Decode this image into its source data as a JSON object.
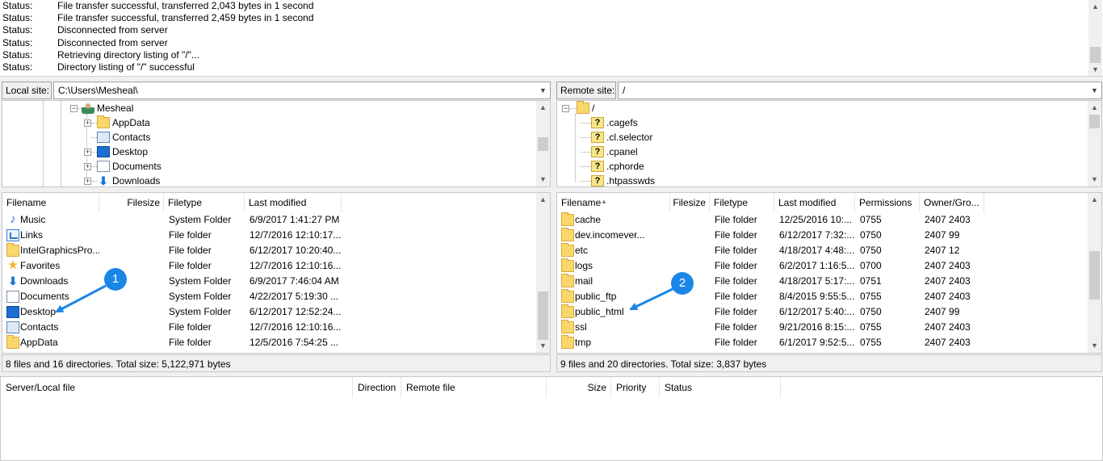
{
  "log": {
    "lines": [
      {
        "label": "Status:",
        "text": "File transfer successful, transferred 2,043 bytes in 1 second"
      },
      {
        "label": "Status:",
        "text": "File transfer successful, transferred 2,459 bytes in 1 second"
      },
      {
        "label": "Status:",
        "text": "Disconnected from server"
      },
      {
        "label": "Status:",
        "text": "Disconnected from server"
      },
      {
        "label": "Status:",
        "text": "Retrieving directory listing of \"/\"..."
      },
      {
        "label": "Status:",
        "text": "Directory listing of \"/\" successful"
      }
    ]
  },
  "local": {
    "site_label": "Local site:",
    "path": "C:\\Users\\Mesheal\\",
    "tree": [
      {
        "label": "Mesheal",
        "icon": "user-icon",
        "expander": "−"
      },
      {
        "label": "AppData",
        "icon": "folder-icon",
        "expander": "+"
      },
      {
        "label": "Contacts",
        "icon": "contacts-icon",
        "expander": ""
      },
      {
        "label": "Desktop",
        "icon": "desktop-icon",
        "expander": "+"
      },
      {
        "label": "Documents",
        "icon": "document-icon",
        "expander": "+"
      },
      {
        "label": "Downloads",
        "icon": "downloads-icon",
        "expander": "+"
      }
    ],
    "columns": {
      "filename": "Filename",
      "filesize": "Filesize",
      "filetype": "Filetype",
      "modified": "Last modified"
    },
    "files": [
      {
        "name": "Music",
        "size": "",
        "type": "System Folder",
        "modified": "6/9/2017 1:41:27 PM",
        "icon": "music-icon"
      },
      {
        "name": "Links",
        "size": "",
        "type": "File folder",
        "modified": "12/7/2016 12:10:17...",
        "icon": "links-icon"
      },
      {
        "name": "IntelGraphicsPro...",
        "size": "",
        "type": "File folder",
        "modified": "6/12/2017 10:20:40...",
        "icon": "folder-icon"
      },
      {
        "name": "Favorites",
        "size": "",
        "type": "File folder",
        "modified": "12/7/2016 12:10:16...",
        "icon": "star-icon"
      },
      {
        "name": "Downloads",
        "size": "",
        "type": "System Folder",
        "modified": "6/9/2017 7:46:04 AM",
        "icon": "downloads-icon"
      },
      {
        "name": "Documents",
        "size": "",
        "type": "System Folder",
        "modified": "4/22/2017 5:19:30 ...",
        "icon": "document-icon"
      },
      {
        "name": "Desktop",
        "size": "",
        "type": "System Folder",
        "modified": "6/12/2017 12:52:24...",
        "icon": "desktop-icon"
      },
      {
        "name": "Contacts",
        "size": "",
        "type": "File folder",
        "modified": "12/7/2016 12:10:16...",
        "icon": "contacts-icon"
      },
      {
        "name": "AppData",
        "size": "",
        "type": "File folder",
        "modified": "12/5/2016 7:54:25 ...",
        "icon": "folder-icon"
      }
    ],
    "status": "8 files and 16 directories. Total size: 5,122,971 bytes"
  },
  "remote": {
    "site_label": "Remote site:",
    "path": "/",
    "tree": [
      {
        "label": "/",
        "icon": "folder-icon",
        "expander": "−"
      },
      {
        "label": ".cagefs",
        "icon": "unknown-folder-icon",
        "expander": ""
      },
      {
        "label": ".cl.selector",
        "icon": "unknown-folder-icon",
        "expander": ""
      },
      {
        "label": ".cpanel",
        "icon": "unknown-folder-icon",
        "expander": ""
      },
      {
        "label": ".cphorde",
        "icon": "unknown-folder-icon",
        "expander": ""
      },
      {
        "label": ".htpasswds",
        "icon": "unknown-folder-icon",
        "expander": ""
      }
    ],
    "unknown_glyph": "?",
    "columns": {
      "filename": "Filename",
      "filesize": "Filesize",
      "filetype": "Filetype",
      "modified": "Last modified",
      "permissions": "Permissions",
      "owner": "Owner/Gro..."
    },
    "files": [
      {
        "name": "cache",
        "size": "",
        "type": "File folder",
        "modified": "12/25/2016 10:...",
        "perm": "0755",
        "owner": "2407 2403"
      },
      {
        "name": "dev.incomever...",
        "size": "",
        "type": "File folder",
        "modified": "6/12/2017 7:32:...",
        "perm": "0750",
        "owner": "2407 99"
      },
      {
        "name": "etc",
        "size": "",
        "type": "File folder",
        "modified": "4/18/2017 4:48:...",
        "perm": "0750",
        "owner": "2407 12"
      },
      {
        "name": "logs",
        "size": "",
        "type": "File folder",
        "modified": "6/2/2017 1:16:5...",
        "perm": "0700",
        "owner": "2407 2403"
      },
      {
        "name": "mail",
        "size": "",
        "type": "File folder",
        "modified": "4/18/2017 5:17:...",
        "perm": "0751",
        "owner": "2407 2403"
      },
      {
        "name": "public_ftp",
        "size": "",
        "type": "File folder",
        "modified": "8/4/2015 9:55:5...",
        "perm": "0755",
        "owner": "2407 2403"
      },
      {
        "name": "public_html",
        "size": "",
        "type": "File folder",
        "modified": "6/12/2017 5:40:...",
        "perm": "0750",
        "owner": "2407 99"
      },
      {
        "name": "ssl",
        "size": "",
        "type": "File folder",
        "modified": "9/21/2016 8:15:...",
        "perm": "0755",
        "owner": "2407 2403"
      },
      {
        "name": "tmp",
        "size": "",
        "type": "File folder",
        "modified": "6/1/2017 9:52:5...",
        "perm": "0755",
        "owner": "2407 2403"
      }
    ],
    "status": "9 files and 20 directories. Total size: 3,837 bytes"
  },
  "queue": {
    "columns": {
      "local": "Server/Local file",
      "direction": "Direction",
      "remote": "Remote file",
      "size": "Size",
      "priority": "Priority",
      "status": "Status"
    }
  },
  "annotations": [
    {
      "label": "1",
      "target": "Desktop"
    },
    {
      "label": "2",
      "target": "public_html"
    }
  ],
  "colors": {
    "badge": "#1a86e6",
    "arrow": "#1a86e6",
    "folder": "#f9d76b"
  }
}
